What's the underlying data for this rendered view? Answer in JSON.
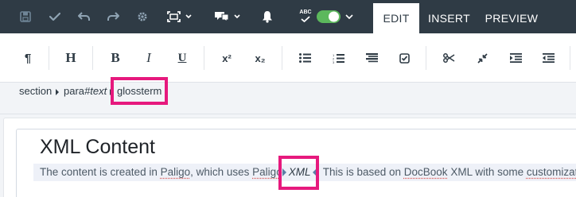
{
  "toolbar": {
    "icons": [
      "save-icon",
      "check-icon",
      "undo-icon",
      "redo-icon",
      "settings-icon",
      "fullscreen-icon",
      "comments-icon",
      "notifications-icon",
      "spellcheck-icon"
    ],
    "spellcheck_label": "ABC",
    "spellcheck_on": true,
    "tabs": [
      {
        "label": "EDIT",
        "active": true
      },
      {
        "label": "INSERT",
        "active": false
      },
      {
        "label": "PREVIEW",
        "active": false
      }
    ]
  },
  "format": {
    "para": "¶",
    "heading": "H",
    "bold": "B",
    "italic": "I",
    "underline": "U",
    "superscript": "x²",
    "subscript": "x₂"
  },
  "breadcrumb": {
    "section": "section",
    "para": "para",
    "para_role": "#text",
    "glossterm": "glossterm"
  },
  "editor": {
    "title": "XML Content",
    "text_1": "The content is created in ",
    "paligo_1": "Paligo",
    "text_2": ", which uses ",
    "paligo_2": "Paligo",
    "glossterm": "XML",
    "text_3": ". This is based on ",
    "docbook": "DocBook",
    "text_4": " XML with some ",
    "customization": "customization"
  },
  "colors": {
    "topbar": "#2f3b45",
    "toggle_on": "#5cb85c",
    "highlight": "#e6197d",
    "glossterm_marker": "#5b7ea6"
  }
}
